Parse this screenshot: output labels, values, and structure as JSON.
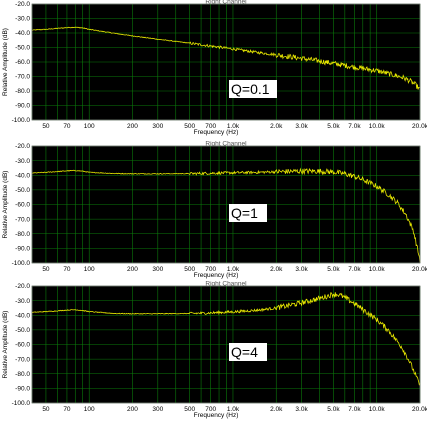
{
  "colors": {
    "background": "#000000",
    "grid": "#0b7a0b",
    "trace": "#e8e800",
    "label_box": "#ffffff"
  },
  "chart_data": [
    {
      "type": "line",
      "title": "Right Channel",
      "xlabel": "Frequency (Hz)",
      "ylabel": "Relative Amplitude (dB)",
      "x_scale": "log",
      "xlim": [
        40,
        20000
      ],
      "ylim": [
        -100,
        -20
      ],
      "grid": true,
      "x_ticks": [
        "50",
        "70",
        "100",
        "200",
        "300",
        "500",
        "700",
        "1.0k",
        "2.0k",
        "3.0k",
        "5.0k",
        "7.0k",
        "10.0k",
        "20.0k"
      ],
      "y_ticks": [
        "-20.0",
        "-30.0",
        "-40.0",
        "-50.0",
        "-60.0",
        "-70.0",
        "-80.0",
        "-90.0",
        "-100.0"
      ],
      "annotation": "Q=0.1",
      "series": [
        {
          "x": [
            40,
            50,
            60,
            70,
            80,
            90,
            100,
            150,
            200,
            300,
            400,
            500,
            700,
            1000,
            1500,
            2000,
            3000,
            4000,
            5000,
            7000,
            10000,
            12000,
            15000,
            17000,
            18500,
            20000
          ],
          "y": [
            -38,
            -37.5,
            -36.8,
            -36.3,
            -36,
            -36.5,
            -37.5,
            -40.2,
            -42,
            -44.3,
            -45.8,
            -47,
            -49,
            -51,
            -53.5,
            -55,
            -57.5,
            -59.3,
            -61,
            -63.5,
            -66,
            -68,
            -70.5,
            -73,
            -75.5,
            -79
          ]
        }
      ]
    },
    {
      "type": "line",
      "title": "Right Channel",
      "xlabel": "Frequency (Hz)",
      "ylabel": "Relative Amplitude (dB)",
      "x_scale": "log",
      "xlim": [
        40,
        20000
      ],
      "ylim": [
        -100,
        -20
      ],
      "grid": true,
      "x_ticks": [
        "50",
        "70",
        "100",
        "200",
        "300",
        "500",
        "700",
        "1.0k",
        "2.0k",
        "3.0k",
        "5.0k",
        "7.0k",
        "10.0k",
        "20.0k"
      ],
      "y_ticks": [
        "-20.0",
        "-30.0",
        "-40.0",
        "-50.0",
        "-60.0",
        "-70.0",
        "-80.0",
        "-90.0",
        "-100.0"
      ],
      "annotation": "Q=1",
      "series": [
        {
          "x": [
            40,
            50,
            60,
            70,
            80,
            90,
            100,
            150,
            200,
            300,
            500,
            700,
            1000,
            1500,
            2000,
            3000,
            4000,
            5000,
            6000,
            7000,
            8000,
            10000,
            12000,
            14000,
            16000,
            18000,
            20000
          ],
          "y": [
            -38.5,
            -38,
            -37.5,
            -37,
            -36.8,
            -37.2,
            -38,
            -38.8,
            -39,
            -39,
            -38.9,
            -38.6,
            -38.3,
            -38,
            -37.6,
            -37.2,
            -37.2,
            -37.8,
            -39,
            -40.8,
            -43,
            -47.5,
            -53,
            -59,
            -67,
            -78,
            -98
          ]
        }
      ]
    },
    {
      "type": "line",
      "title": "Right Channel",
      "xlabel": "Frequency (Hz)",
      "ylabel": "Relative Amplitude (dB)",
      "x_scale": "log",
      "xlim": [
        40,
        20000
      ],
      "ylim": [
        -100,
        -20
      ],
      "grid": true,
      "x_ticks": [
        "50",
        "70",
        "100",
        "200",
        "300",
        "500",
        "700",
        "1.0k",
        "2.0k",
        "3.0k",
        "5.0k",
        "7.0k",
        "10.0k",
        "20.0k"
      ],
      "y_ticks": [
        "-20.0",
        "-30.0",
        "-40.0",
        "-50.0",
        "-60.0",
        "-70.0",
        "-80.0",
        "-90.0",
        "-100.0"
      ],
      "annotation": "Q=4",
      "series": [
        {
          "x": [
            40,
            50,
            60,
            70,
            80,
            90,
            100,
            150,
            200,
            300,
            500,
            700,
            1000,
            1500,
            2000,
            3000,
            4000,
            4500,
            5000,
            5500,
            6000,
            7000,
            8000,
            10000,
            12000,
            15000,
            17000,
            20000
          ],
          "y": [
            -38,
            -37.5,
            -37,
            -36.5,
            -36.2,
            -36.8,
            -37.5,
            -38.8,
            -39,
            -39,
            -38.8,
            -38.4,
            -37.7,
            -36.5,
            -35,
            -31.5,
            -28.5,
            -27,
            -25.5,
            -26,
            -28,
            -32,
            -36,
            -43,
            -50,
            -62,
            -72,
            -88
          ]
        }
      ]
    }
  ]
}
